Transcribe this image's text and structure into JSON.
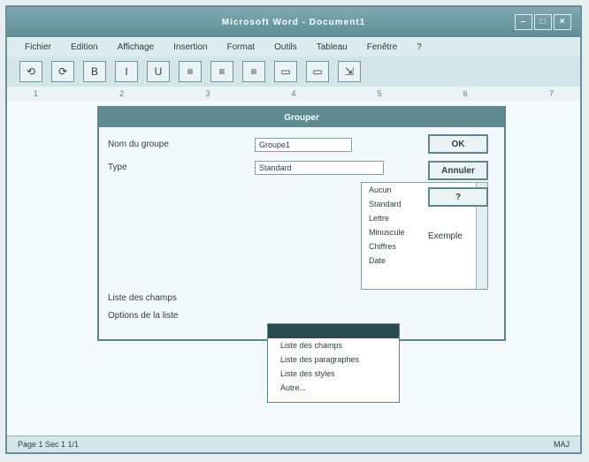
{
  "window": {
    "title": "Microsoft Word - Document1",
    "controls": [
      "–",
      "□",
      "×"
    ]
  },
  "menu": [
    "Fichier",
    "Edition",
    "Affichage",
    "Insertion",
    "Format",
    "Outils",
    "Tableau",
    "Fenêtre",
    "?"
  ],
  "toolbar": {
    "buttons": [
      "⟲",
      "⟳",
      "B",
      "I",
      "U",
      "≡",
      "≡",
      "≡",
      "▭",
      "▭",
      "⇲"
    ]
  },
  "ruler": {
    "ticks": [
      "1",
      "2",
      "3",
      "4",
      "5",
      "6",
      "7"
    ]
  },
  "dialog": {
    "title": "Grouper",
    "labels": {
      "group_name": "Nom du groupe",
      "type": "Type",
      "fields": "Liste des champs",
      "options": "Options de la liste"
    },
    "fields": {
      "group_name": "Groupe1",
      "type": "Standard"
    },
    "list_items": [
      "Aucun",
      "Standard",
      "Lettre",
      "Minuscule",
      "Chiffres",
      "Date"
    ],
    "buttons": {
      "ok": "OK",
      "cancel": "Annuler",
      "help": "?"
    },
    "side_text": "Exemple"
  },
  "dropdown": {
    "items": [
      "Liste des champs",
      "Liste des paragraphes",
      "Liste des styles",
      "Autre..."
    ]
  },
  "status": {
    "left": "Page 1  Sec 1  1/1",
    "right": "MAJ"
  }
}
